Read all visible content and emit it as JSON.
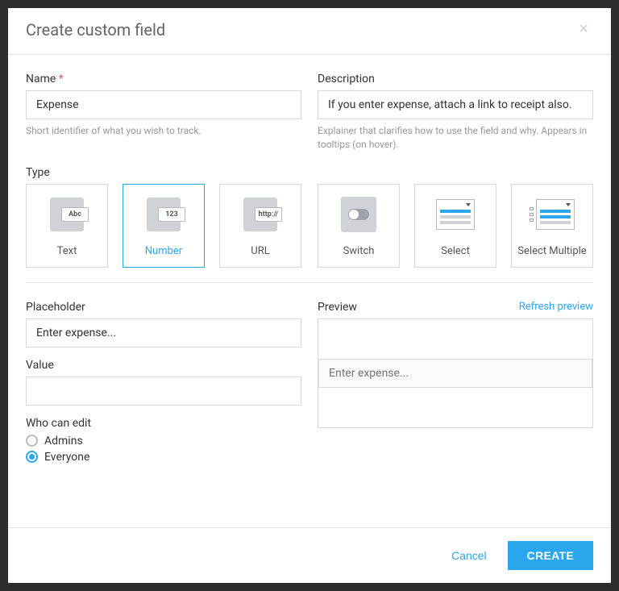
{
  "modal": {
    "title": "Create custom field"
  },
  "name": {
    "label": "Name",
    "value": "Expense",
    "hint": "Short identifier of what you wish to track."
  },
  "description": {
    "label": "Description",
    "value": "If you enter expense, attach a link to receipt also.",
    "hint": "Explainer that clarifies how to use the field and why. Appears in tooltips (on hover)."
  },
  "type": {
    "label": "Type",
    "selected": "Number",
    "options": [
      {
        "key": "text",
        "label": "Text",
        "tag": "Abc"
      },
      {
        "key": "number",
        "label": "Number",
        "tag": "123"
      },
      {
        "key": "url",
        "label": "URL",
        "tag": "http://"
      },
      {
        "key": "switch",
        "label": "Switch"
      },
      {
        "key": "select",
        "label": "Select"
      },
      {
        "key": "select_multiple",
        "label": "Select Multiple"
      }
    ]
  },
  "placeholder": {
    "label": "Placeholder",
    "value": "Enter expense..."
  },
  "value": {
    "label": "Value",
    "value": ""
  },
  "who_can_edit": {
    "label": "Who can edit",
    "options": [
      "Admins",
      "Everyone"
    ],
    "selected": "Everyone"
  },
  "preview": {
    "label": "Preview",
    "refresh_link": "Refresh preview",
    "placeholder": "Enter expense..."
  },
  "footer": {
    "cancel": "Cancel",
    "create": "CREATE"
  }
}
